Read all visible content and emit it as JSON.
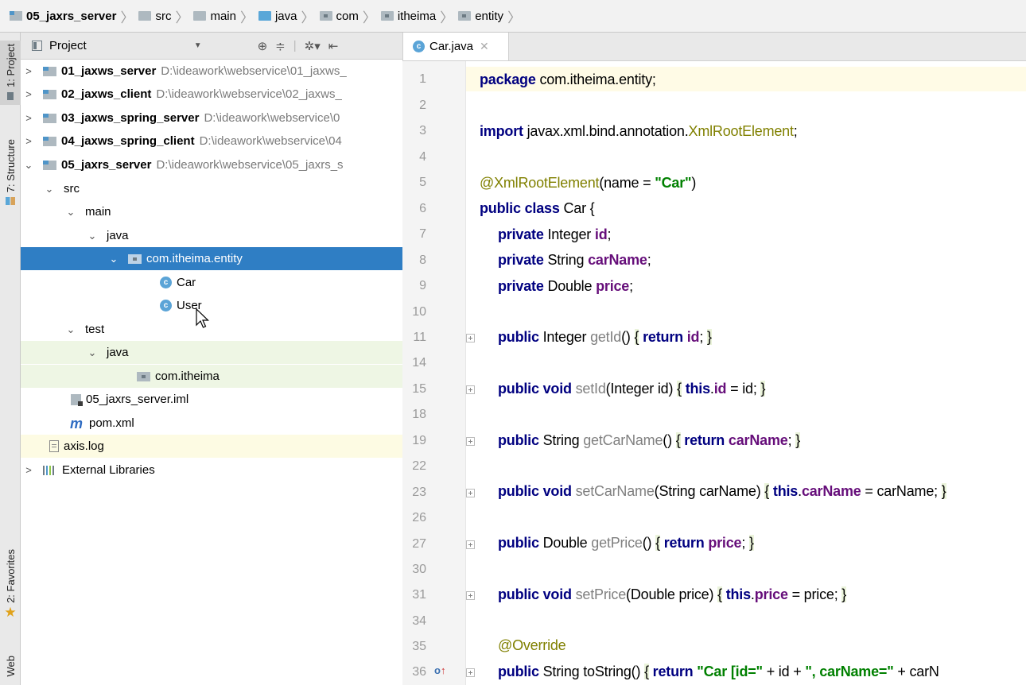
{
  "breadcrumb": {
    "items": [
      {
        "label": "05_jaxrs_server",
        "icon": "module-icon"
      },
      {
        "label": "src",
        "icon": "folder-icon"
      },
      {
        "label": "main",
        "icon": "folder-icon"
      },
      {
        "label": "java",
        "icon": "source-folder-icon"
      },
      {
        "label": "com",
        "icon": "package-icon"
      },
      {
        "label": "itheima",
        "icon": "package-icon"
      },
      {
        "label": "entity",
        "icon": "package-icon"
      }
    ]
  },
  "sidebar_tabs": {
    "project": "1: Project",
    "structure": "7: Structure",
    "favorites": "2: Favorites",
    "web": "Web"
  },
  "project_panel": {
    "title": "Project",
    "tree": [
      {
        "label": "01_jaxws_server",
        "path": "D:\\ideawork\\webservice\\01_jaxws_",
        "bold": true
      },
      {
        "label": "02_jaxws_client",
        "path": "D:\\ideawork\\webservice\\02_jaxws_",
        "bold": true
      },
      {
        "label": "03_jaxws_spring_server",
        "path": "D:\\ideawork\\webservice\\0",
        "bold": true
      },
      {
        "label": "04_jaxws_spring_client",
        "path": "D:\\ideawork\\webservice\\04",
        "bold": true
      },
      {
        "label": "05_jaxrs_server",
        "path": "D:\\ideawork\\webservice\\05_jaxrs_s",
        "bold": true
      },
      {
        "label": "src"
      },
      {
        "label": "main"
      },
      {
        "label": "java"
      },
      {
        "label": "com.itheima.entity",
        "selected": true
      },
      {
        "label": "Car"
      },
      {
        "label": "User"
      },
      {
        "label": "test"
      },
      {
        "label": "java"
      },
      {
        "label": "com.itheima"
      },
      {
        "label": "05_jaxrs_server.iml"
      },
      {
        "label": "pom.xml"
      },
      {
        "label": "axis.log"
      },
      {
        "label": "External Libraries"
      }
    ]
  },
  "editor": {
    "tab_label": "Car.java",
    "line_numbers": [
      "1",
      "2",
      "3",
      "4",
      "5",
      "6",
      "7",
      "8",
      "9",
      "10",
      "11",
      "14",
      "15",
      "18",
      "19",
      "22",
      "23",
      "26",
      "27",
      "30",
      "31",
      "34",
      "35",
      "36"
    ],
    "code": {
      "l1": {
        "kw": "package",
        "rest": " com.itheima.entity;"
      },
      "l3": {
        "kw": "import",
        "pre": " javax.xml.bind.annotation.",
        "cls": "XmlRootElement",
        "post": ";"
      },
      "l5": {
        "ann": "@XmlRootElement",
        "pre": "(name = ",
        "str": "\"Car\"",
        "post": ")"
      },
      "l6": {
        "kw": "public class",
        "rest": " Car {"
      },
      "l7": {
        "kw": "private",
        "type": " Integer ",
        "field": "id",
        "post": ";"
      },
      "l8": {
        "kw": "private",
        "type": " String ",
        "field": "carName",
        "post": ";"
      },
      "l9": {
        "kw": "private",
        "type": " Double ",
        "field": "price",
        "post": ";"
      },
      "l11": {
        "kw": "public",
        "type": " Integer ",
        "name": "getId",
        "args": "() ",
        "ob": "{",
        "kw2": " return ",
        "field": "id",
        "post": "; ",
        "cb": "}"
      },
      "l15": {
        "kw": "public void",
        "name": " setId",
        "args": "(Integer id) ",
        "ob": "{",
        "kw2": " this",
        "dot": ".",
        "field": "id",
        "post": " = id; ",
        "cb": "}"
      },
      "l19": {
        "kw": "public",
        "type": " String ",
        "name": "getCarName",
        "args": "() ",
        "ob": "{",
        "kw2": " return ",
        "field": "carName",
        "post": "; ",
        "cb": "}"
      },
      "l23": {
        "kw": "public void",
        "name": " setCarName",
        "args": "(String carName) ",
        "ob": "{",
        "kw2": " this",
        "dot": ".",
        "field": "carName",
        "post": " = carName; ",
        "cb": "}"
      },
      "l27": {
        "kw": "public",
        "type": " Double ",
        "name": "getPrice",
        "args": "() ",
        "ob": "{",
        "kw2": " return ",
        "field": "price",
        "post": "; ",
        "cb": "}"
      },
      "l31": {
        "kw": "public void",
        "name": " setPrice",
        "args": "(Double price) ",
        "ob": "{",
        "kw2": " this",
        "dot": ".",
        "field": "price",
        "post": " = price; ",
        "cb": "}"
      },
      "l35": {
        "ann": "@Override"
      },
      "l36": {
        "kw": "public",
        "type": " String toString() ",
        "ob": "{",
        "kw2": " return ",
        "s1": "\"Car [id=\"",
        "p1": " + id + ",
        "s2": "\", carName=\"",
        "p2": " + carN"
      }
    }
  }
}
